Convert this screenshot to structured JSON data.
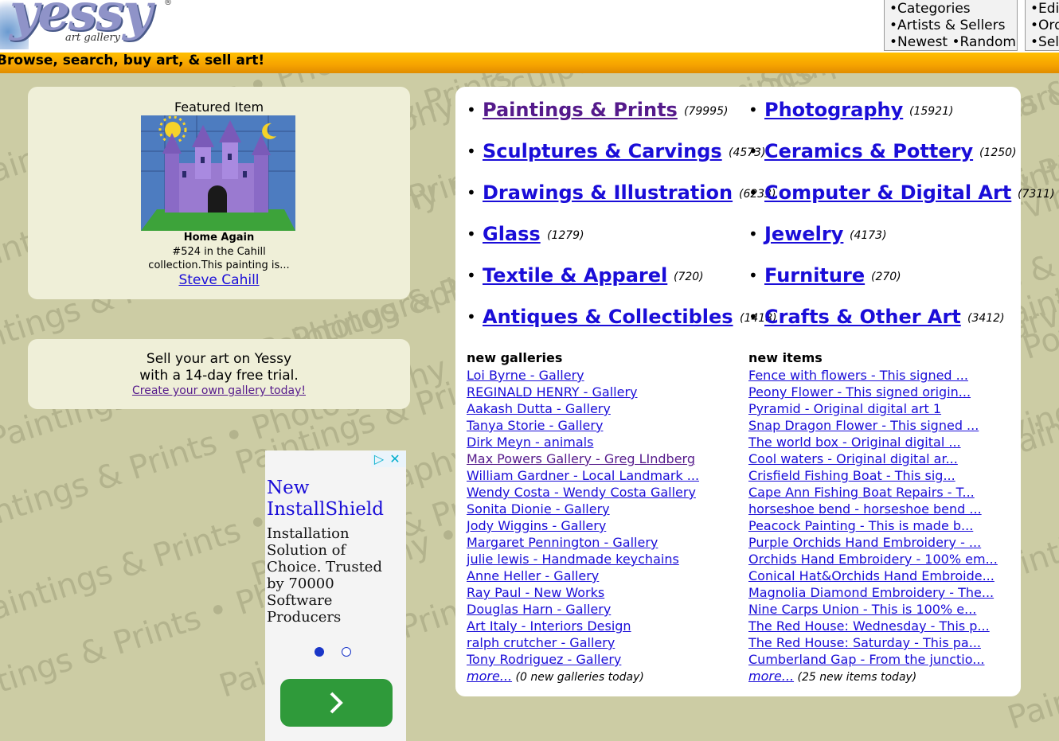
{
  "header": {
    "logo_text": "yessy",
    "logo_sub": "art gallery",
    "logo_reg": "®",
    "nav_left": [
      "•Categories",
      "•Artists & Sellers",
      "•Newest  •Random"
    ],
    "nav_right": [
      "•Edi",
      "•Ord",
      "•Sell"
    ],
    "tagline": "Browse, search, buy art, & sell art!"
  },
  "featured": {
    "title": "Featured Item",
    "name": "Home Again",
    "desc_line1": "#524 in the Cahill",
    "desc_line2": "collection.This painting is...",
    "artist": "Steve Cahill"
  },
  "sell": {
    "line1": "Sell your art on Yessy",
    "line2": "with a 14-day free trial.",
    "link": "Create your own gallery today!"
  },
  "ad": {
    "headline1": "New",
    "headline2": "InstallShield",
    "body": "Installation Solution of Choice. Trusted by 70000 Software Producers",
    "icon_info": "▷",
    "icon_close": "✕"
  },
  "categories": [
    {
      "name": "Paintings & Prints",
      "count": "(79995)",
      "visited": true
    },
    {
      "name": "Photography",
      "count": "(15921)"
    },
    {
      "name": "Sculptures & Carvings",
      "count": "(4573)"
    },
    {
      "name": "Ceramics & Pottery",
      "count": "(1250)"
    },
    {
      "name": "Drawings & Illustration",
      "count": "(6233)"
    },
    {
      "name": "Computer & Digital Art",
      "count": "(7311)"
    },
    {
      "name": "Glass",
      "count": "(1279)"
    },
    {
      "name": "Jewelry",
      "count": "(4173)"
    },
    {
      "name": "Textile & Apparel",
      "count": "(720)"
    },
    {
      "name": "Furniture",
      "count": "(270)"
    },
    {
      "name": "Antiques & Collectibles",
      "count": "(1418)"
    },
    {
      "name": "Crafts & Other Art",
      "count": "(3412)"
    }
  ],
  "new_galleries": {
    "title": "new galleries",
    "items": [
      "Loi Byrne - Gallery",
      "REGINALD HENRY - Gallery",
      "Aakash Dutta - Gallery",
      "Tanya Storie - Gallery",
      "Dirk Meyn - animals",
      "Max Powers Gallery - Greg LIndberg",
      "William Gardner - Local Landmark ...",
      "Wendy Costa - Wendy Costa Gallery",
      "Sonita Dionie - Gallery",
      "Jody Wiggins - Gallery",
      "Margaret Pennington - Gallery",
      "julie lewis - Handmade keychains",
      "Anne Heller - Gallery",
      "Ray Paul - New Works",
      "Douglas Harn - Gallery",
      "Art Italy - Interiors Design",
      "ralph crutcher - Gallery",
      "Tony Rodriguez - Gallery"
    ],
    "more": "more...",
    "note": "(0 new galleries today)"
  },
  "new_items": {
    "title": "new items",
    "items": [
      "Fence with flowers - This signed ...",
      "Peony Flower - This signed origin...",
      "Pyramid - Original digital art 1",
      "Snap Dragon Flower - This signed ...",
      "The world box - Original digital ...",
      "Cool waters - Original digital ar...",
      "Crisfield Fishing Boat - This sig...",
      "Cape Ann Fishing Boat Repairs - T...",
      "horseshoe bend - horseshoe bend ...",
      "Peacock Painting - This is made b...",
      "Purple Orchids Hand Embroidery - ...",
      "Orchids Hand Embroidery - 100% em...",
      "Conical Hat&Orchids Hand Embroide...",
      "Magnolia Diamond Embroidery - The...",
      "Nine Carps Union - This is 100% e...",
      "The Red House: Wednesday - This p...",
      "The Red House: Saturday - This pa...",
      "Cumberland Gap - From the junctio..."
    ],
    "more": "more...",
    "note": "(25 new items today)"
  },
  "watermark_text": "Paintings & Prints • Photography • Sculptures & Carvings • Ceramics & Pottery • Drawings & Illustration • Computer & Digital Art • Glass • Jewelry • Crafts • Furniture • Antiques & Collectibles"
}
